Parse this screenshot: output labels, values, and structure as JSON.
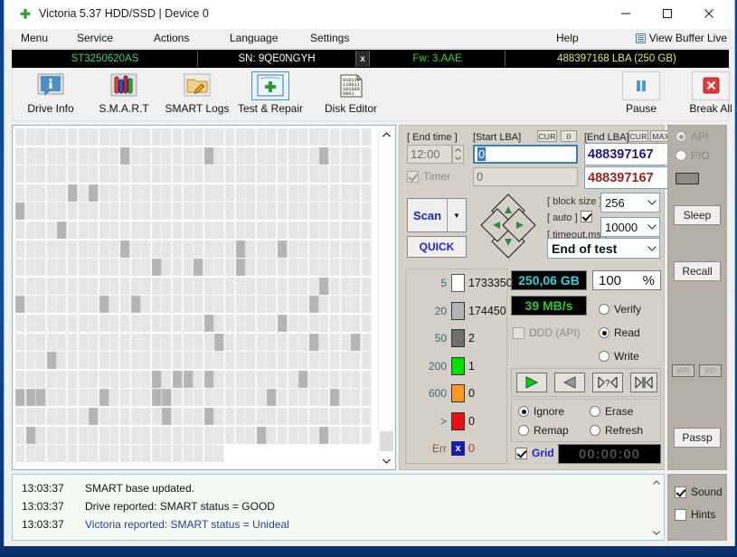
{
  "window": {
    "title": "Victoria 5.37 HDD/SSD | Device 0",
    "app_icon": "green-cross-icon",
    "minimize": "—",
    "maximize": "□",
    "close": "✕"
  },
  "menubar": {
    "items": [
      "Menu",
      "Service",
      "Actions",
      "Language",
      "Settings",
      "Help"
    ],
    "view_buffer_live": "View Buffer Live"
  },
  "drive_strip": {
    "model": "ST3250620AS",
    "serial": "SN: 9QE0NGYH",
    "close_mark": "x",
    "firmware": "Fw: 3.AAE",
    "capacity": "488397168 LBA (250 GB)"
  },
  "toolbar": {
    "buttons": [
      {
        "label": "Drive Info",
        "icon": "info-bubble-icon"
      },
      {
        "label": "S.M.A.R.T",
        "icon": "test-tubes-icon"
      },
      {
        "label": "SMART Logs",
        "icon": "folder-pencil-icon"
      },
      {
        "label": "Test & Repair",
        "icon": "first-aid-kit-icon"
      },
      {
        "label": "Disk Editor",
        "icon": "binary-page-icon"
      }
    ],
    "right_buttons": [
      {
        "label": "Pause",
        "icon": "pause-icon"
      },
      {
        "label": "Break All",
        "icon": "red-x-icon"
      }
    ]
  },
  "controls": {
    "end_time_label": "[ End time ]",
    "end_time_value": "12:00",
    "timer_label": "Timer",
    "timer_checked": true,
    "start_lba_label": "[Start LBA]",
    "start_lba_cur": "CUR",
    "start_lba_zero": "0",
    "start_lba_value": "0",
    "start_lba_second": "0",
    "end_lba_label": "[End LBA]",
    "end_lba_cur": "CUR",
    "end_lba_max": "MAX",
    "end_lba_value": "488397167",
    "end_lba_second": "488397167",
    "scan_label": "Scan",
    "scan_dropdown": "▼",
    "quick_label": "QUICK",
    "block_size_label": "[ block size ]",
    "block_size_value": "256",
    "auto_label": "[ auto ]",
    "auto_checked": true,
    "timeout_label": "[ timeout,ms ]",
    "timeout_value": "10000",
    "end_of_test_value": "End of test",
    "nav_icon": "diamond-dpad-icon"
  },
  "legend": {
    "rows": [
      {
        "threshold": "5",
        "color": "#ffffff",
        "count": "1733350"
      },
      {
        "threshold": "20",
        "color": "#b4b4b4",
        "count": "174450"
      },
      {
        "threshold": "50",
        "color": "#6e6e6e",
        "count": "2"
      },
      {
        "threshold": "200",
        "color": "#00e000",
        "count": "1"
      },
      {
        "threshold": "600",
        "color": "#ff9922",
        "count": "0"
      },
      {
        "threshold": ">",
        "color": "#e81010",
        "count": "0"
      },
      {
        "threshold": "Err",
        "color": "#1414c8",
        "count": "0"
      }
    ],
    "err_mark": "x"
  },
  "stats": {
    "size_value": "250,06 GB",
    "percent_value": "100",
    "percent_unit": "%",
    "speed_value": "39 MB/s",
    "ddd_label": "DDD (API)",
    "ddd_checked": false,
    "modes": [
      {
        "label": "Verify",
        "selected": false
      },
      {
        "label": "Read",
        "selected": true
      },
      {
        "label": "Write",
        "selected": false
      }
    ],
    "transport": [
      {
        "icon": "play-forward-icon",
        "glyph": "▶"
      },
      {
        "icon": "play-backward-icon",
        "glyph": "◀"
      },
      {
        "icon": "seek-question-icon",
        "glyph": "?"
      },
      {
        "icon": "seek-end-icon",
        "glyph": "|"
      }
    ],
    "actions": [
      {
        "label": "Ignore",
        "selected": true
      },
      {
        "label": "Erase",
        "selected": false
      },
      {
        "label": "Remap",
        "selected": false
      },
      {
        "label": "Refresh",
        "selected": false
      }
    ],
    "grid_label": "Grid",
    "grid_checked": true,
    "elapsed": "00:00:00"
  },
  "right_panel": {
    "api_label": "API",
    "api_selected": true,
    "pio_label": "PIO",
    "pio_selected": false,
    "indicator": "",
    "sleep_label": "Sleep",
    "recall_label": "Recall",
    "wr_label": "WR",
    "rd_label": "RD",
    "passp_label": "Passp"
  },
  "log": {
    "rows": [
      {
        "time": "13:03:37",
        "message": "SMART base updated.",
        "style": "normal"
      },
      {
        "time": "13:03:37",
        "message": "Drive reported: SMART status = GOOD",
        "style": "normal"
      },
      {
        "time": "13:03:37",
        "message": "Victoria reported: SMART status = Unideal",
        "style": "blue"
      }
    ]
  },
  "options": {
    "sound_label": "Sound",
    "sound_checked": true,
    "hints_label": "Hints",
    "hints_checked": false
  },
  "colors": {
    "accent_blue": "#2222cc",
    "cyan": "#35d0d0",
    "green": "#35d435",
    "yellow": "#e6e67a",
    "desktop": "#0d3e86"
  }
}
